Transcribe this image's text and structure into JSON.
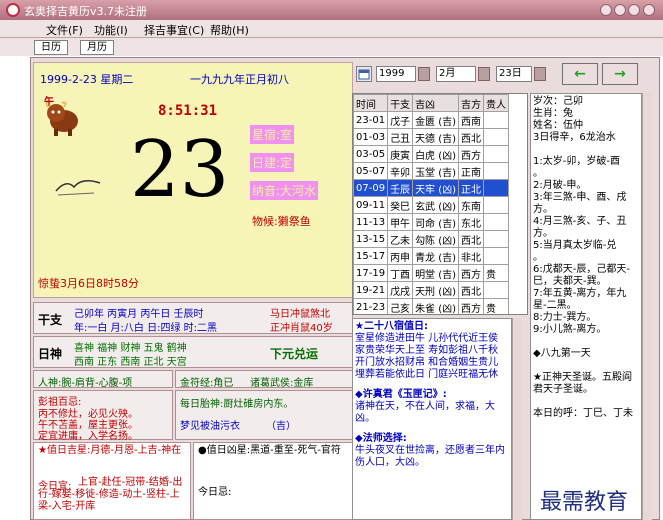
{
  "window": {
    "title": "玄奥择吉黄历v3.7未注册"
  },
  "menu": [
    "文件(F)",
    "功能(I)",
    "择吉事宜(C)",
    "帮助(H)"
  ],
  "tabs": [
    "日历",
    "月历"
  ],
  "day": {
    "date_line": "1999-2-23 星期二",
    "lunar": "一九九九年正月初八",
    "zodiac_char": "午",
    "time": "8:51:31",
    "number": "23",
    "star": "星宿:室",
    "jianchu": "日建:定",
    "nayin": "纳音:大河水",
    "wuhou": "物候:獭祭鱼",
    "jieqi": "惊蛰3月6日8时58分"
  },
  "ganzhi": {
    "label": "干支",
    "line1": "己卯年 丙寅月 丙午日 壬辰时",
    "line2": "年:一白 月:八白 日:四绿 时:二黑",
    "chong1": "马日冲鼠煞北",
    "chong2": "正冲肖鼠40岁"
  },
  "shen": {
    "label": "日神",
    "line1": "喜神 福神 财神 五鬼 鹤神",
    "line2": "西南 正东 西南 正北 天宫",
    "yuan": "下元兑运"
  },
  "info": {
    "renshen": "人神:腕-肩背-心腹-项",
    "jinfu": "金符经:角已",
    "zhuwu": "诸葛武侯:金库",
    "pengzu_title": "彭祖百忌:",
    "pengzu1": "丙不修灶，必见火殃。",
    "pengzu2": "午不苫盖，屋主更张。",
    "pengzu3": "定宜进庸，入学名扬。",
    "taishen": "每日胎神:厨灶碓房内东。",
    "dream": "梦见被油污衣",
    "dream_jx": "（吉）",
    "jishen_title": "★值日吉星:",
    "jishen": "月德-月恩-上吉-神在",
    "yi_title": "今日宜:",
    "yi": "上官-赴任-冠带-结婚-出行-嫁娶-移徙-修造-动土-竖柱-上梁-入宅-开库",
    "xiong_title": "●值日凶星:",
    "xiong": "黑道-重至-死气-官符",
    "ji_title": "今日忌:"
  },
  "picker": {
    "year": "1999",
    "month": "2月",
    "day": "23日",
    "prev": "←",
    "next": "→"
  },
  "hours": {
    "headers": [
      "时间",
      "干支",
      "吉凶",
      "吉方",
      "贵人"
    ],
    "rows": [
      [
        "23-01",
        "戊子",
        "金匮 (吉)",
        "西南",
        ""
      ],
      [
        "01-03",
        "己丑",
        "天德 (吉)",
        "西北",
        ""
      ],
      [
        "03-05",
        "庚寅",
        "白虎 (凶)",
        "西方",
        ""
      ],
      [
        "05-07",
        "辛卯",
        "玉堂 (吉)",
        "正南",
        ""
      ],
      [
        "07-09",
        "壬辰",
        "天牢 (凶)",
        "正北",
        ""
      ],
      [
        "09-11",
        "癸巳",
        "玄武 (凶)",
        "东南",
        ""
      ],
      [
        "11-13",
        "甲午",
        "司命 (吉)",
        "东北",
        ""
      ],
      [
        "13-15",
        "乙未",
        "勾陈 (凶)",
        "西北",
        ""
      ],
      [
        "15-17",
        "丙申",
        "青龙 (吉)",
        "非北",
        ""
      ],
      [
        "17-19",
        "丁酉",
        "明堂 (吉)",
        "西方",
        "贵"
      ],
      [
        "19-21",
        "戊戌",
        "天刑 (凶)",
        "西北",
        ""
      ],
      [
        "21-23",
        "己亥",
        "朱雀 (凶)",
        "西方",
        "贵"
      ]
    ]
  },
  "right_text": [
    "岁次：己卯",
    "生肖：兔",
    "姓名：伍仲",
    "3日得辛，6龙治水",
    "",
    "1:太岁-卯，岁破-酉",
    "。",
    "2:月破-申。",
    "3:年三煞-申、酉、戌方。",
    "4:月三煞-亥、子、丑方。",
    "5:当月真太岁临-兑",
    "。",
    "6:戊都天-辰，己都天-巳，夫都天-巽。",
    "7:年五黄-离方，年九星-二黑。",
    "8:力士-巽方。",
    "9:小儿煞-离方。",
    "",
    "◆八九第一天",
    "",
    "★正神天圣诞。五殿阎君天子圣诞。",
    "",
    "本日的呼：丁巳、丁未"
  ],
  "bottom_text": {
    "t1": "★二十八宿值日:",
    "b1": "室星修造进田牛 儿孙代代近王侯 家贵荣华天上至 寿如彭祖八千秋 开门放水招财帛 和合婚姻生贵儿 埋葬若能依此日 门庭兴旺福无休",
    "t2": "◆许真君《玉匣记》:",
    "b2": "诸神在天，不在人间，求福，大凶。",
    "t3": "◆法师选择:",
    "b3": "牛头夜叉在世捡离，还愿者三年内伤人口，大凶。"
  },
  "watermark": "最需教育"
}
